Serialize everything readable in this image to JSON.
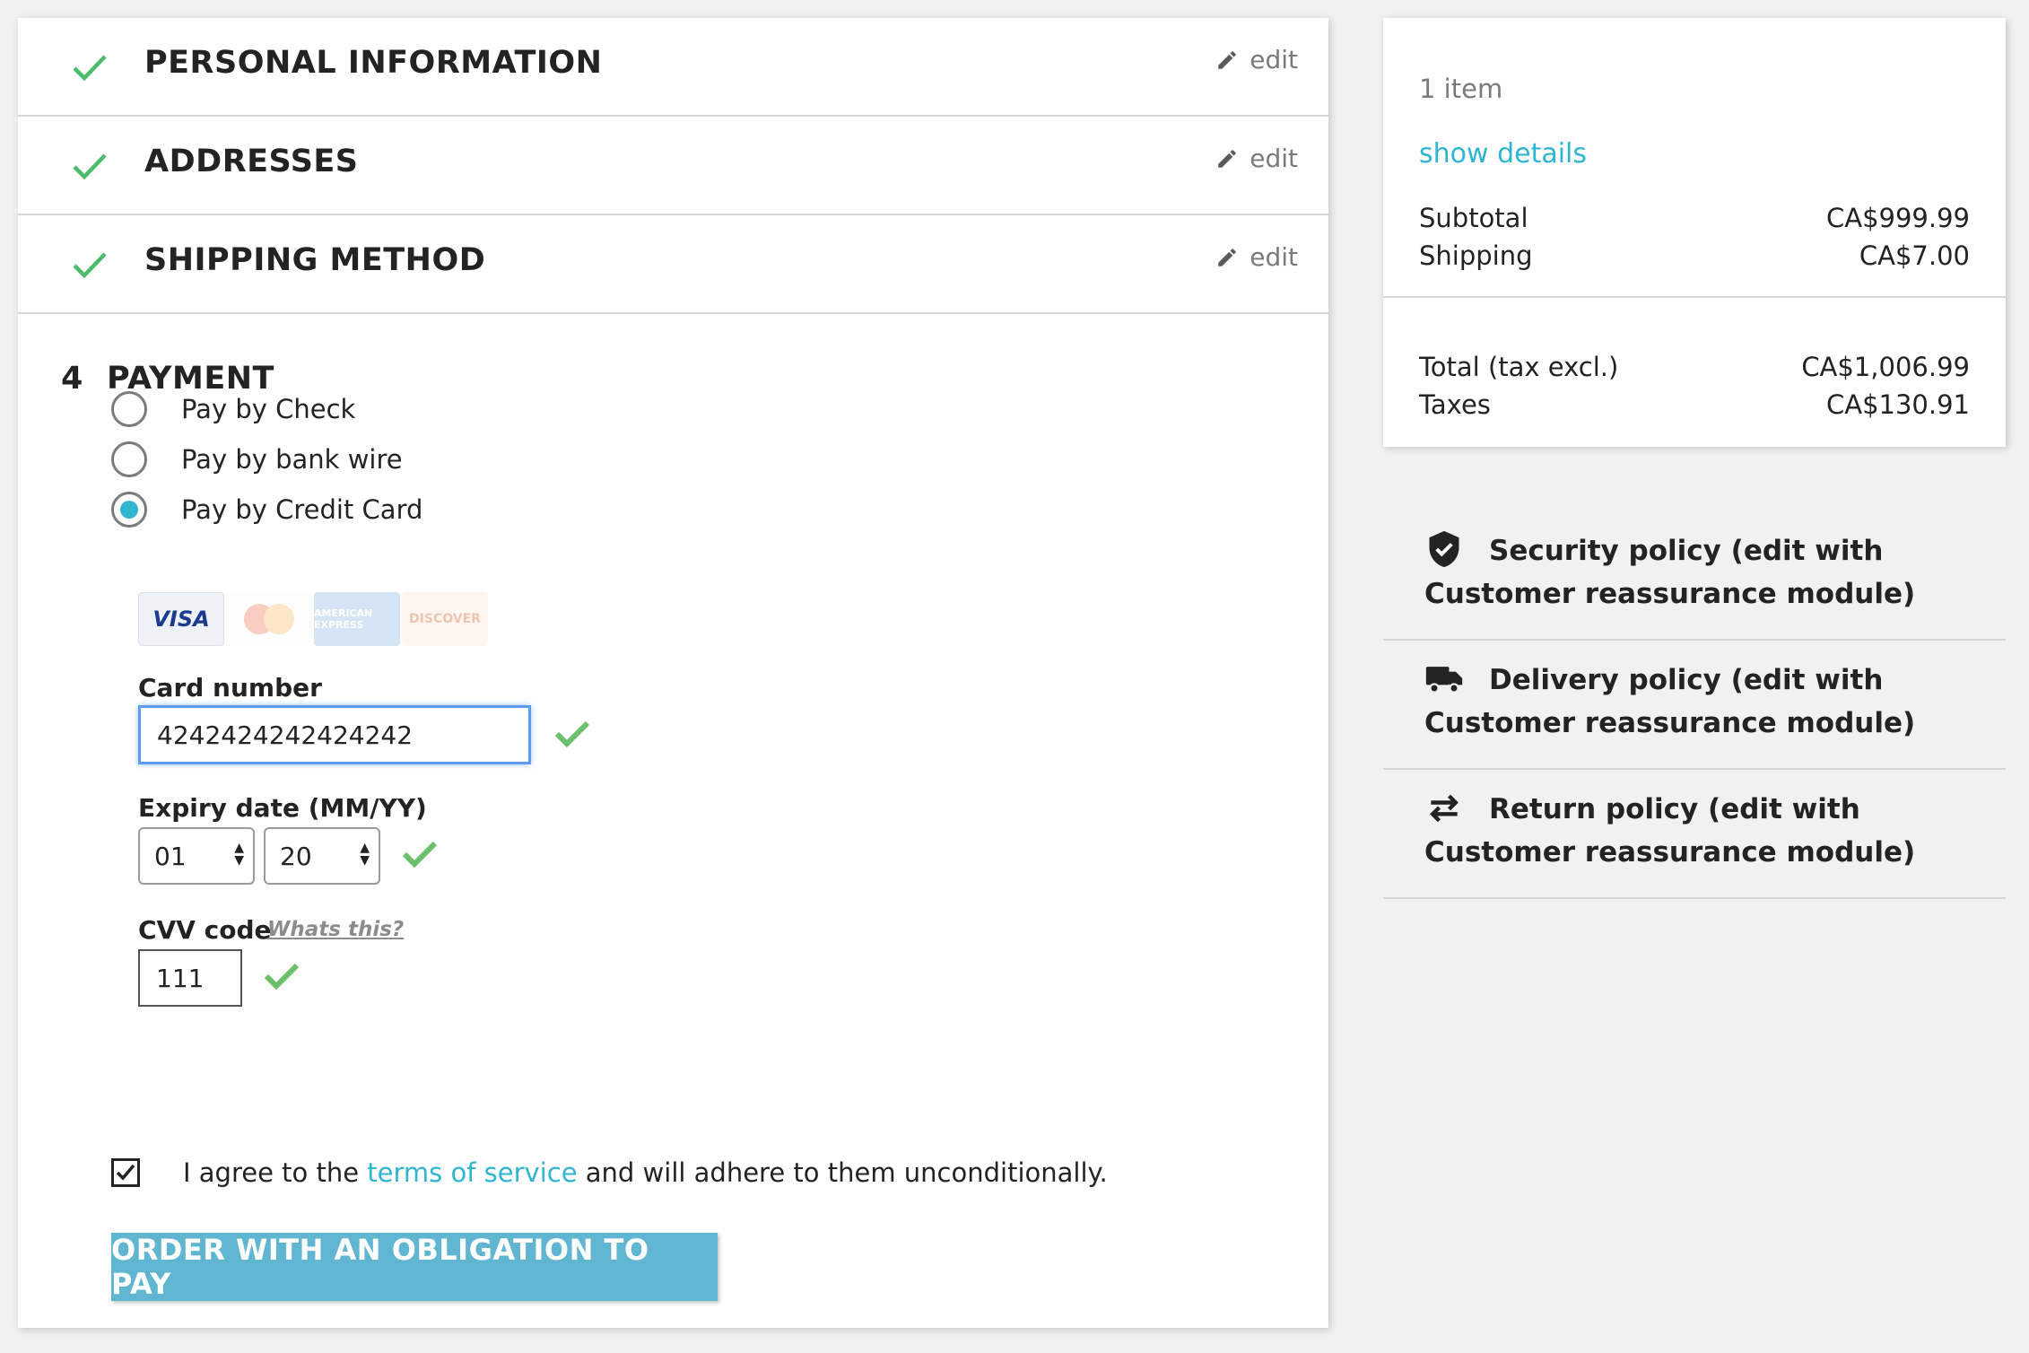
{
  "steps": [
    {
      "title": "PERSONAL INFORMATION",
      "edit": "edit"
    },
    {
      "title": "ADDRESSES",
      "edit": "edit"
    },
    {
      "title": "SHIPPING METHOD",
      "edit": "edit"
    }
  ],
  "payment": {
    "number": "4",
    "title": "PAYMENT",
    "options": [
      "Pay by Check",
      "Pay by bank wire",
      "Pay by Credit Card"
    ],
    "selected": "Pay by Credit Card",
    "cards": [
      "VISA",
      "mastercard",
      "AMERICAN EXPRESS",
      "DISCOVER"
    ],
    "card_number_label": "Card number",
    "card_number": "4242424242424242",
    "expiry_label": "Expiry date (MM/YY)",
    "expiry_month": "01",
    "expiry_year": "20",
    "cvv_label": "CVV code",
    "cvv_help": "Whats this?",
    "cvv": "111"
  },
  "terms": {
    "prefix": "I agree to the",
    "link": "terms of service",
    "suffix": "and will adhere to them unconditionally.",
    "checked": true
  },
  "order_button": "ORDER WITH AN OBLIGATION TO PAY",
  "summary": {
    "items": "1 item",
    "show_details": "show details",
    "subtotal_label": "Subtotal",
    "subtotal": "CA$999.99",
    "shipping_label": "Shipping",
    "shipping": "CA$7.00",
    "total_label": "Total (tax excl.)",
    "total": "CA$1,006.99",
    "taxes_label": "Taxes",
    "taxes": "CA$130.91"
  },
  "reassurance": [
    {
      "icon": "shield-check-icon",
      "text": "Security policy (edit with Customer reassurance module)"
    },
    {
      "icon": "truck-icon",
      "text": "Delivery policy (edit with Customer reassurance module)"
    },
    {
      "icon": "exchange-arrows-icon",
      "text": "Return policy (edit with Customer reassurance module)"
    }
  ],
  "colors": {
    "accent": "#2fb5d2",
    "check_green": "#4cbb6c",
    "button": "#60b6d0"
  }
}
